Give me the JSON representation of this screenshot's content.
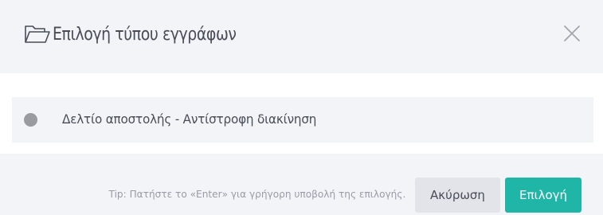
{
  "dialog": {
    "title": "Επιλογή τύπου εγγράφων",
    "title_icon": "folder-open-icon",
    "close_icon": "close-icon"
  },
  "options": [
    {
      "label": "Δελτίο αποστολής - Αντίστροφη διακίνηση",
      "selected": false
    }
  ],
  "footer": {
    "tip": "Tip: Πατήστε το «Enter» για γρήγορη υποβολή της επιλογής.",
    "cancel_label": "Ακύρωση",
    "select_label": "Επιλογή"
  },
  "colors": {
    "accent": "#1fb6a7",
    "background": "#f3f4f8",
    "text": "#4a4d57",
    "muted_text": "#9a9ba6",
    "radio": "#9a9ba1"
  }
}
